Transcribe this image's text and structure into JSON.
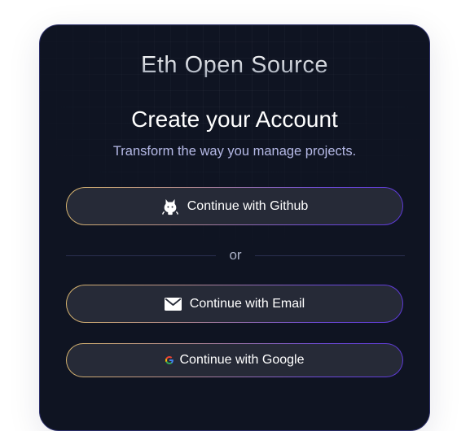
{
  "brand": {
    "name": "Eth Open Source"
  },
  "header": {
    "title": "Create your Account",
    "subtitle": "Transform the way you manage projects."
  },
  "auth": {
    "github_label": "Continue with Github",
    "divider_label": "or",
    "email_label": "Continue with Email",
    "google_label": "Continue with Google"
  },
  "icons": {
    "github": "github-icon",
    "email": "envelope-icon",
    "google": "google-icon"
  },
  "colors": {
    "card_background": "#0f1422",
    "button_background": "#262a37",
    "border_gradient_start": "#d6b46d",
    "border_gradient_end": "#5c39d6",
    "subtitle_text": "#b5b9e6"
  }
}
